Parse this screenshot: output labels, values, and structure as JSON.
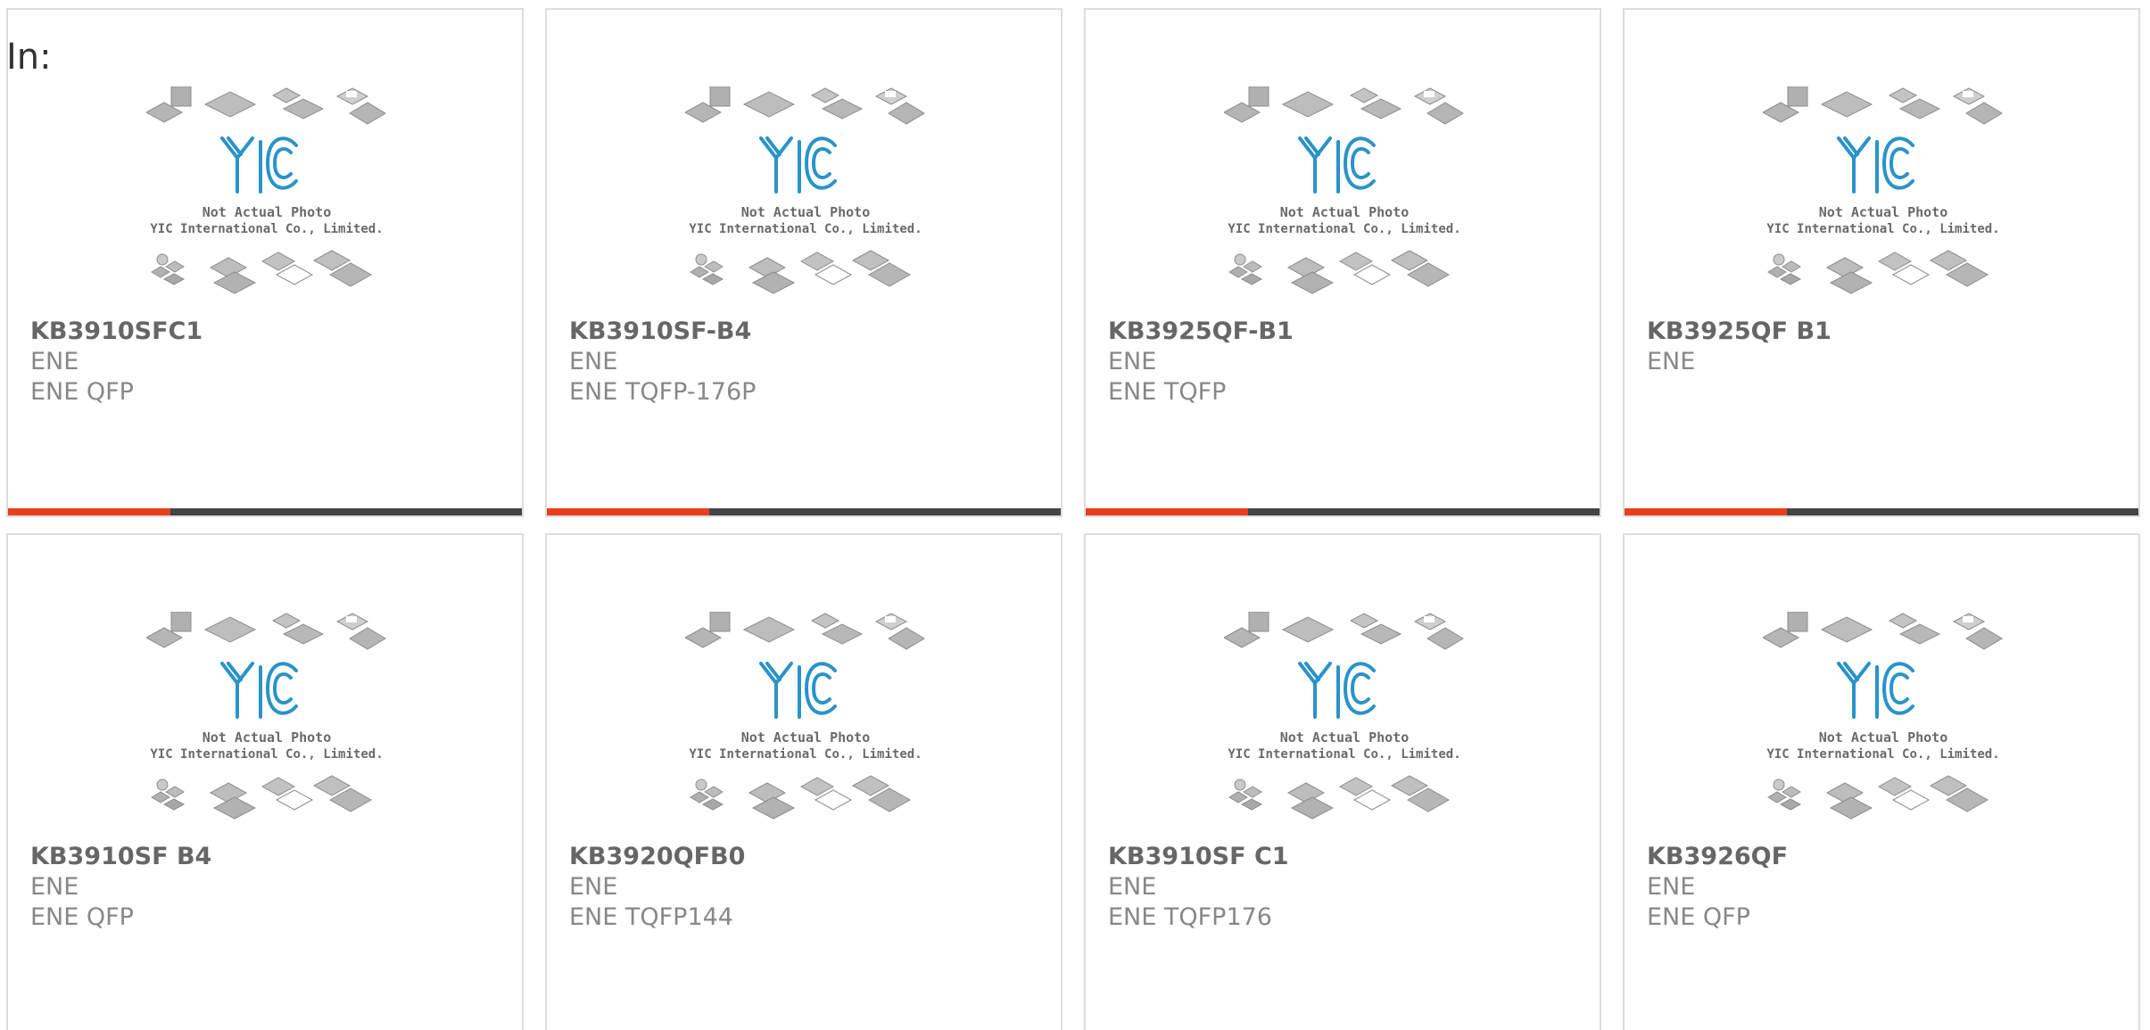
{
  "page": {
    "label": "In:"
  },
  "placeholder_image": {
    "icon": "yic-placeholder-photo",
    "logo_text": "YIC",
    "caption_line1": "Not Actual Photo",
    "caption_line2": "YIC International Co., Limited."
  },
  "colors": {
    "accent": "#e8401c",
    "bar": "#444444",
    "logo_blue": "#2a93c9"
  },
  "products": [
    {
      "part": "KB3910SFC1",
      "brand": "ENE",
      "package": "ENE QFP"
    },
    {
      "part": "KB3910SF-B4",
      "brand": "ENE",
      "package": "ENE TQFP-176P"
    },
    {
      "part": "KB3925QF-B1",
      "brand": "ENE",
      "package": "ENE TQFP"
    },
    {
      "part": "KB3925QF B1",
      "brand": "ENE",
      "package": ""
    },
    {
      "part": "KB3910SF B4",
      "brand": "ENE",
      "package": "ENE QFP"
    },
    {
      "part": "KB3920QFB0",
      "brand": "ENE",
      "package": "ENE TQFP144"
    },
    {
      "part": "KB3910SF C1",
      "brand": "ENE",
      "package": "ENE TQFP176"
    },
    {
      "part": "KB3926QF",
      "brand": "ENE",
      "package": "ENE QFP"
    }
  ]
}
